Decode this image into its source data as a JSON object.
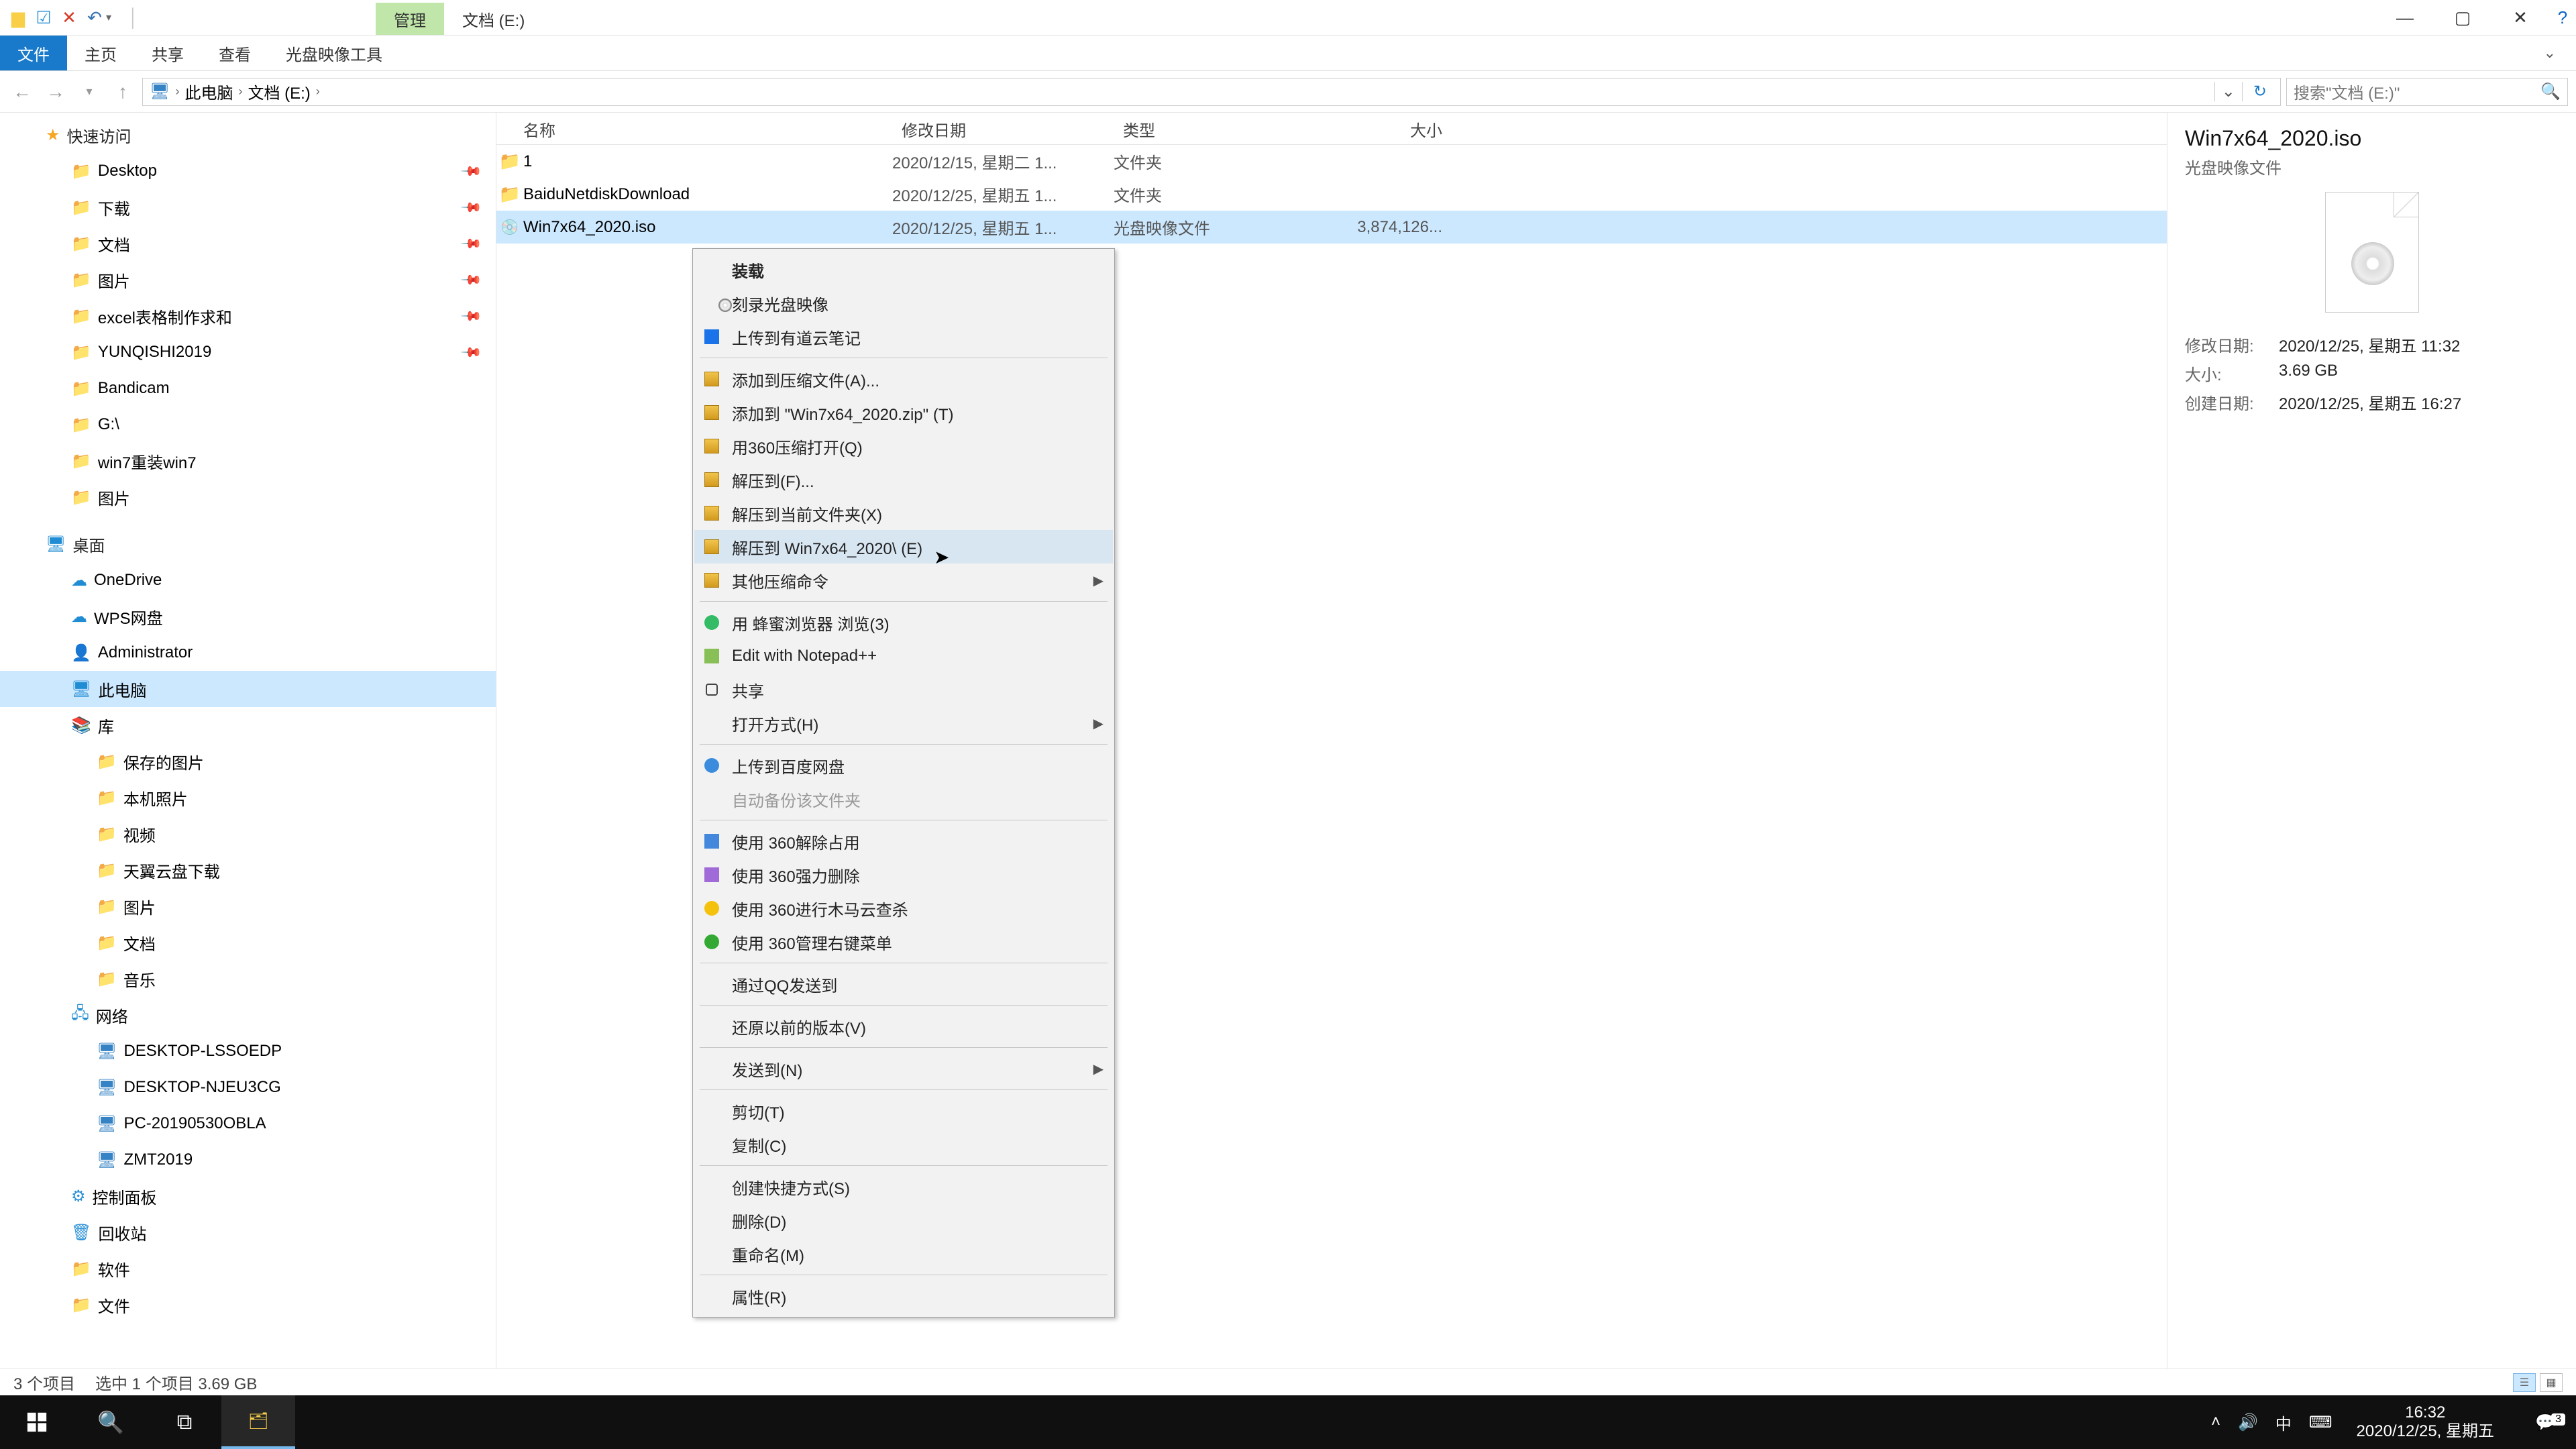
{
  "window": {
    "context_tab": "管理",
    "location_title": "文档 (E:)",
    "minimize": "—",
    "maximize": "▢",
    "close": "✕"
  },
  "ribbon": {
    "file": "文件",
    "tabs": [
      "主页",
      "共享",
      "查看",
      "光盘映像工具"
    ]
  },
  "breadcrumb": {
    "root": "此电脑",
    "segments": [
      "文档 (E:)"
    ],
    "search_placeholder": "搜索\"文档 (E:)\""
  },
  "tree": {
    "quick": "快速访问",
    "quick_items": [
      "Desktop",
      "下载",
      "文档",
      "图片",
      "excel表格制作求和",
      "YUNQISHI2019",
      "Bandicam",
      "G:\\",
      "win7重装win7",
      "图片"
    ],
    "pin_idx": [
      0,
      1,
      2,
      3,
      4,
      5
    ],
    "desktop": "桌面",
    "desktop_items": [
      "OneDrive",
      "WPS网盘",
      "Administrator",
      "此电脑",
      "库"
    ],
    "selected": "此电脑",
    "lib_items": [
      "保存的图片",
      "本机照片",
      "视频",
      "天翼云盘下载",
      "图片",
      "文档",
      "音乐"
    ],
    "network": "网络",
    "net_items": [
      "DESKTOP-LSSOEDP",
      "DESKTOP-NJEU3CG",
      "PC-20190530OBLA",
      "ZMT2019"
    ],
    "bottom": [
      "控制面板",
      "回收站",
      "软件",
      "文件"
    ]
  },
  "columns": {
    "name": "名称",
    "date": "修改日期",
    "type": "类型",
    "size": "大小"
  },
  "rows": [
    {
      "name": "1",
      "date": "2020/12/15, 星期二 1...",
      "type": "文件夹",
      "size": "",
      "icon": "folder"
    },
    {
      "name": "BaiduNetdiskDownload",
      "date": "2020/12/25, 星期五 1...",
      "type": "文件夹",
      "size": "",
      "icon": "folder"
    },
    {
      "name": "Win7x64_2020.iso",
      "date": "2020/12/25, 星期五 1...",
      "type": "光盘映像文件",
      "size": "3,874,126...",
      "icon": "iso",
      "selected": true
    }
  ],
  "context": {
    "items": [
      {
        "label": "装载",
        "bold": true,
        "icon": "disc"
      },
      {
        "label": "刻录光盘映像"
      },
      {
        "label": "上传到有道云笔记",
        "icon": "blue"
      },
      {
        "sep": true
      },
      {
        "label": "添加到压缩文件(A)...",
        "icon": "zip"
      },
      {
        "label": "添加到 \"Win7x64_2020.zip\" (T)",
        "icon": "zip"
      },
      {
        "label": "用360压缩打开(Q)",
        "icon": "zip"
      },
      {
        "label": "解压到(F)...",
        "icon": "zip"
      },
      {
        "label": "解压到当前文件夹(X)",
        "icon": "zip"
      },
      {
        "label": "解压到 Win7x64_2020\\ (E)",
        "icon": "zip",
        "hl": true
      },
      {
        "label": "其他压缩命令",
        "icon": "zip",
        "sub": true
      },
      {
        "sep": true
      },
      {
        "label": "用 蜂蜜浏览器 浏览(3)",
        "icon": "bee"
      },
      {
        "label": "Edit with Notepad++",
        "icon": "npp"
      },
      {
        "label": "共享",
        "icon": "share"
      },
      {
        "label": "打开方式(H)",
        "sub": true
      },
      {
        "sep": true
      },
      {
        "label": "上传到百度网盘",
        "icon": "pan"
      },
      {
        "label": "自动备份该文件夹",
        "disabled": true
      },
      {
        "sep": true
      },
      {
        "label": "使用 360解除占用",
        "icon": "trash"
      },
      {
        "label": "使用 360强力删除",
        "icon": "purge"
      },
      {
        "label": "使用 360进行木马云查杀",
        "icon": "y360"
      },
      {
        "label": "使用 360管理右键菜单",
        "icon": "g360"
      },
      {
        "sep": true
      },
      {
        "label": "通过QQ发送到"
      },
      {
        "sep": true
      },
      {
        "label": "还原以前的版本(V)"
      },
      {
        "sep": true
      },
      {
        "label": "发送到(N)",
        "sub": true
      },
      {
        "sep": true
      },
      {
        "label": "剪切(T)"
      },
      {
        "label": "复制(C)"
      },
      {
        "sep": true
      },
      {
        "label": "创建快捷方式(S)"
      },
      {
        "label": "删除(D)"
      },
      {
        "label": "重命名(M)"
      },
      {
        "sep": true
      },
      {
        "label": "属性(R)"
      }
    ]
  },
  "details": {
    "title": "Win7x64_2020.iso",
    "subtitle": "光盘映像文件",
    "fields": [
      {
        "k": "修改日期:",
        "v": "2020/12/25, 星期五 11:32"
      },
      {
        "k": "大小:",
        "v": "3.69 GB"
      },
      {
        "k": "创建日期:",
        "v": "2020/12/25, 星期五 16:27"
      }
    ]
  },
  "status": {
    "items": "3 个项目",
    "selected": "选中 1 个项目  3.69 GB"
  },
  "taskbar": {
    "time": "16:32",
    "date": "2020/12/25, 星期五",
    "ime": "中",
    "badge": "3"
  }
}
